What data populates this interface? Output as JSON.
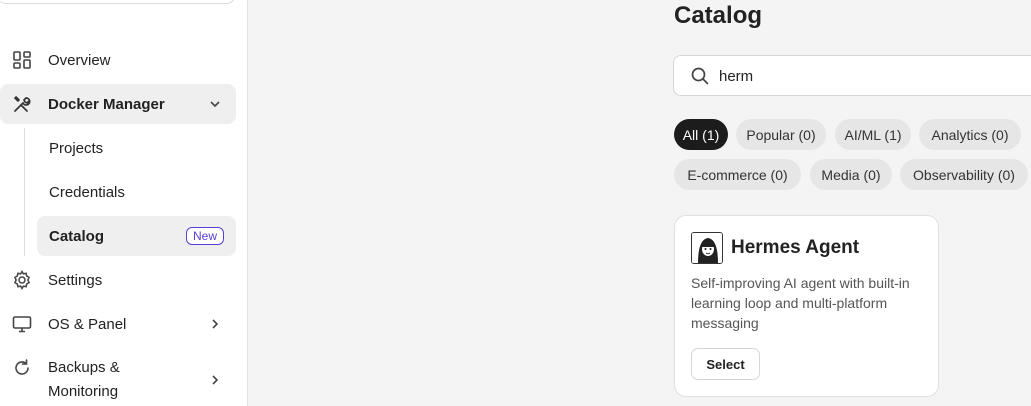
{
  "sidebar": {
    "items": [
      {
        "label": "Overview",
        "icon": "grid-icon"
      },
      {
        "label": "Docker Manager",
        "icon": "tools-icon"
      },
      {
        "label": "Settings",
        "icon": "gear-icon"
      },
      {
        "label": "OS & Panel",
        "icon": "monitor-icon"
      },
      {
        "label_line1": "Backups &",
        "label_line2": "Monitoring",
        "icon": "refresh-icon"
      }
    ],
    "docker_sub": [
      {
        "label": "Projects"
      },
      {
        "label": "Credentials"
      },
      {
        "label": "Catalog",
        "badge": "New"
      }
    ]
  },
  "main": {
    "title": "Catalog",
    "search": {
      "value": "herm",
      "placeholder": ""
    },
    "filters": [
      {
        "label": "All (1)",
        "active": true
      },
      {
        "label": "Popular (0)"
      },
      {
        "label": "AI/ML (1)"
      },
      {
        "label": "Analytics (0)"
      },
      {
        "label": "E-commerce (0)"
      },
      {
        "label": "Media (0)"
      },
      {
        "label": "Observability (0)"
      }
    ],
    "card": {
      "title": "Hermes Agent",
      "description": "Self-improving AI agent with built-in learning loop and multi-platform messaging",
      "button": "Select"
    }
  },
  "colors": {
    "accent": "#5a3fd6",
    "active_chip": "#1c1c1c",
    "chip": "#e6e6e6"
  }
}
